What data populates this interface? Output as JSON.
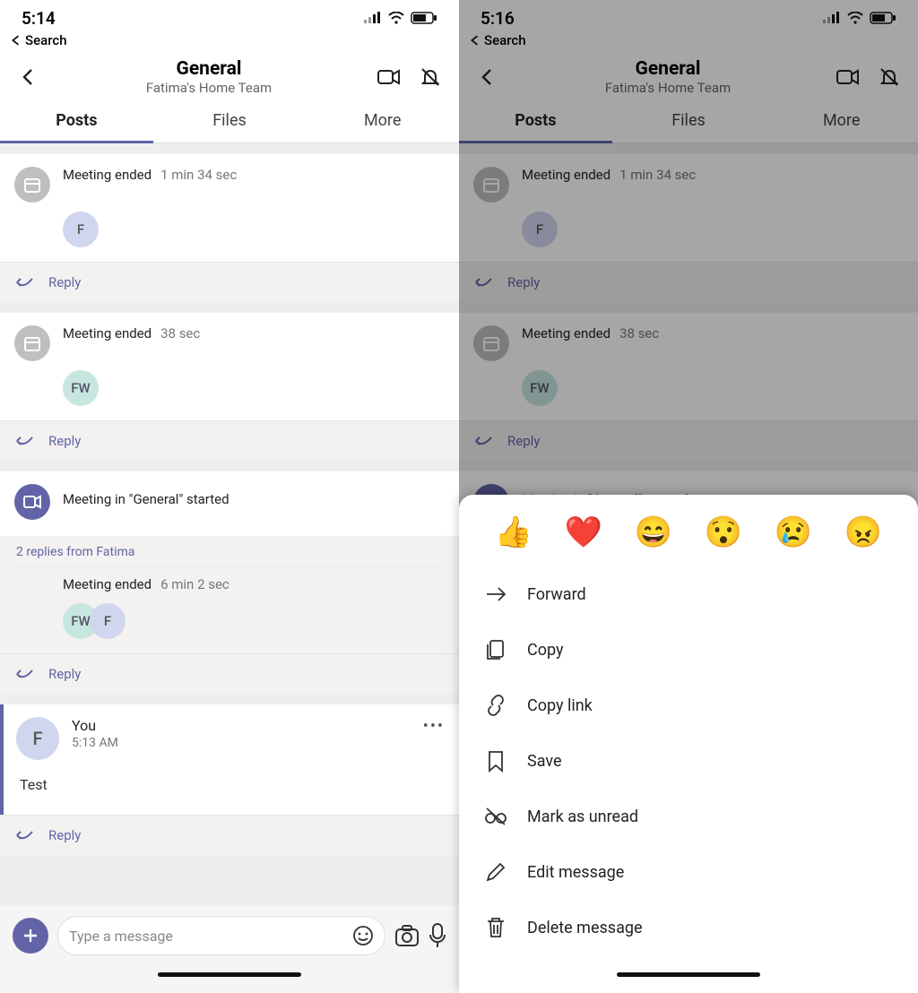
{
  "left": {
    "status": {
      "time": "5:14",
      "back_label": "Search"
    },
    "header": {
      "title": "General",
      "subtitle": "Fatima's Home Team"
    },
    "tabs": {
      "posts": "Posts",
      "files": "Files",
      "more": "More"
    },
    "feed": {
      "item1_label": "Meeting ended",
      "item1_dur": "1 min 34 sec",
      "item1_avatar": "F",
      "item2_label": "Meeting ended",
      "item2_dur": "38 sec",
      "item2_avatar": "FW",
      "item3_text": "Meeting in \"General\"  started",
      "item3_thread": "2 replies from Fatima",
      "item3_sub_label": "Meeting ended",
      "item3_sub_dur": "6 min 2 sec",
      "item3_av1": "FW",
      "item3_av2": "F",
      "msg_sender": "You",
      "msg_time": "5:13 AM",
      "msg_body": "Test",
      "msg_av": "F",
      "reply_label": "Reply"
    },
    "composer": {
      "placeholder": "Type a message"
    }
  },
  "right": {
    "status": {
      "time": "5:16",
      "back_label": "Search"
    },
    "sheet": {
      "reactions": {
        "like": "👍",
        "heart": "❤️",
        "laugh": "😄",
        "surprised": "😯",
        "sad": "😢",
        "angry": "😠"
      },
      "items": {
        "forward": "Forward",
        "copy": "Copy",
        "copylink": "Copy link",
        "save": "Save",
        "unread": "Mark as unread",
        "edit": "Edit message",
        "delete": "Delete message"
      }
    }
  }
}
